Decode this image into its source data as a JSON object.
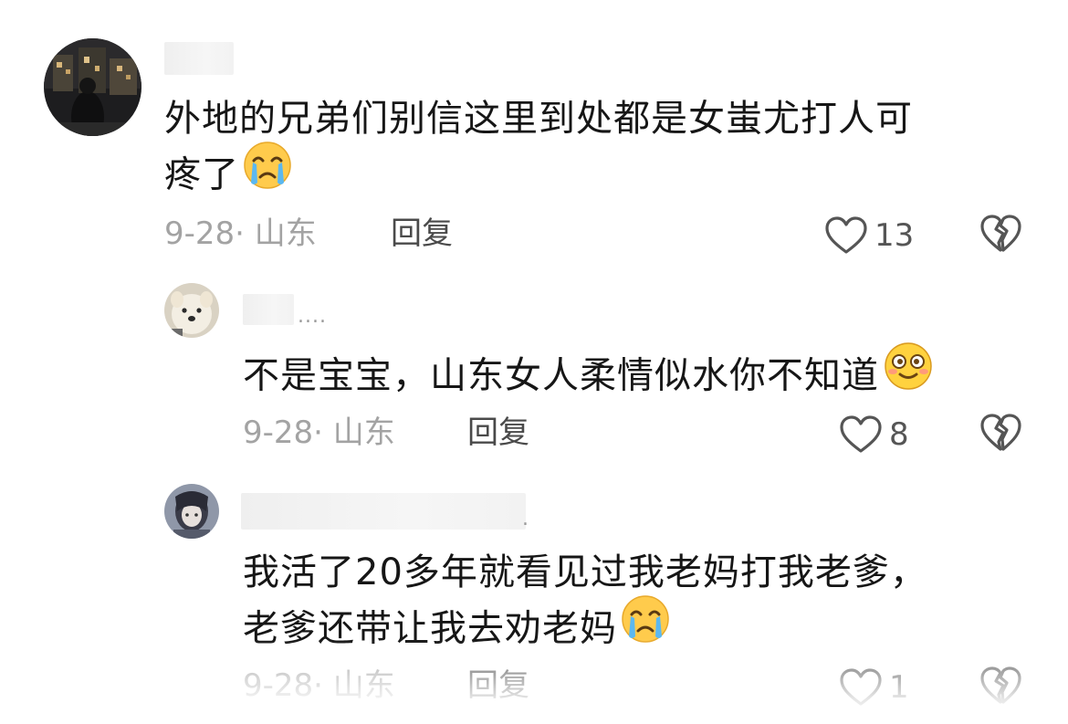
{
  "comments": [
    {
      "text_line1": "外地的兄弟们别信这里到处都是女蚩尤打人可",
      "text_line2": "疼了",
      "emoji_icon": "crying-face-icon",
      "date_location": "9-28· 山东",
      "reply_label": "回复",
      "likes": "13"
    }
  ],
  "replies": [
    {
      "name_suffix": "....",
      "text_line1": "不是宝宝，山东女人柔情似水你不知道",
      "emoji_icon": "smiling-blush-face-icon",
      "date_location": "9-28· 山东",
      "reply_label": "回复",
      "likes": "8"
    },
    {
      "name_suffix": ".",
      "text_line1": "我活了20多年就看见过我老妈打我老爹，",
      "text_line2": "老爹还带让我去劝老妈",
      "emoji_icon": "crying-face-icon",
      "date_location": "9-28· 山东",
      "reply_label": "回复",
      "likes": "1"
    }
  ],
  "colors": {
    "text": "#161616",
    "meta": "#a3a3a3",
    "reply": "#4a4a4a",
    "icon": "#555555"
  }
}
